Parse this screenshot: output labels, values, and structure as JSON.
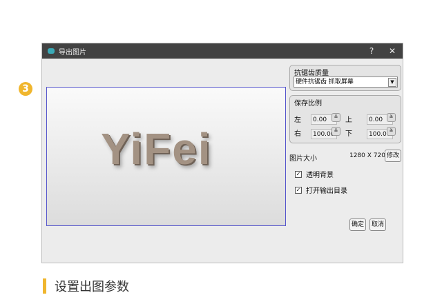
{
  "step_number": "3",
  "dialog": {
    "title": "导出图片",
    "help": "?",
    "close": "✕",
    "preview_text": "YiFei",
    "aa_group": {
      "label": "抗锯齿质量",
      "selected": "硬件抗锯齿 抓取屏幕"
    },
    "ratio_group": {
      "label": "保存比例",
      "left_label": "左",
      "left": "0.00",
      "top_label": "上",
      "top": "0.00",
      "right_label": "右",
      "right": "100.00",
      "bottom_label": "下",
      "bottom": "100.00"
    },
    "size": {
      "label": "图片大小",
      "value": "1280 X 720",
      "modify": "修改"
    },
    "transparent_bg": {
      "label": "透明背景",
      "checked": true
    },
    "open_dir": {
      "label": "打开输出目录",
      "checked": true
    },
    "ok": "确定",
    "cancel": "取消"
  },
  "caption": "设置出图参数"
}
